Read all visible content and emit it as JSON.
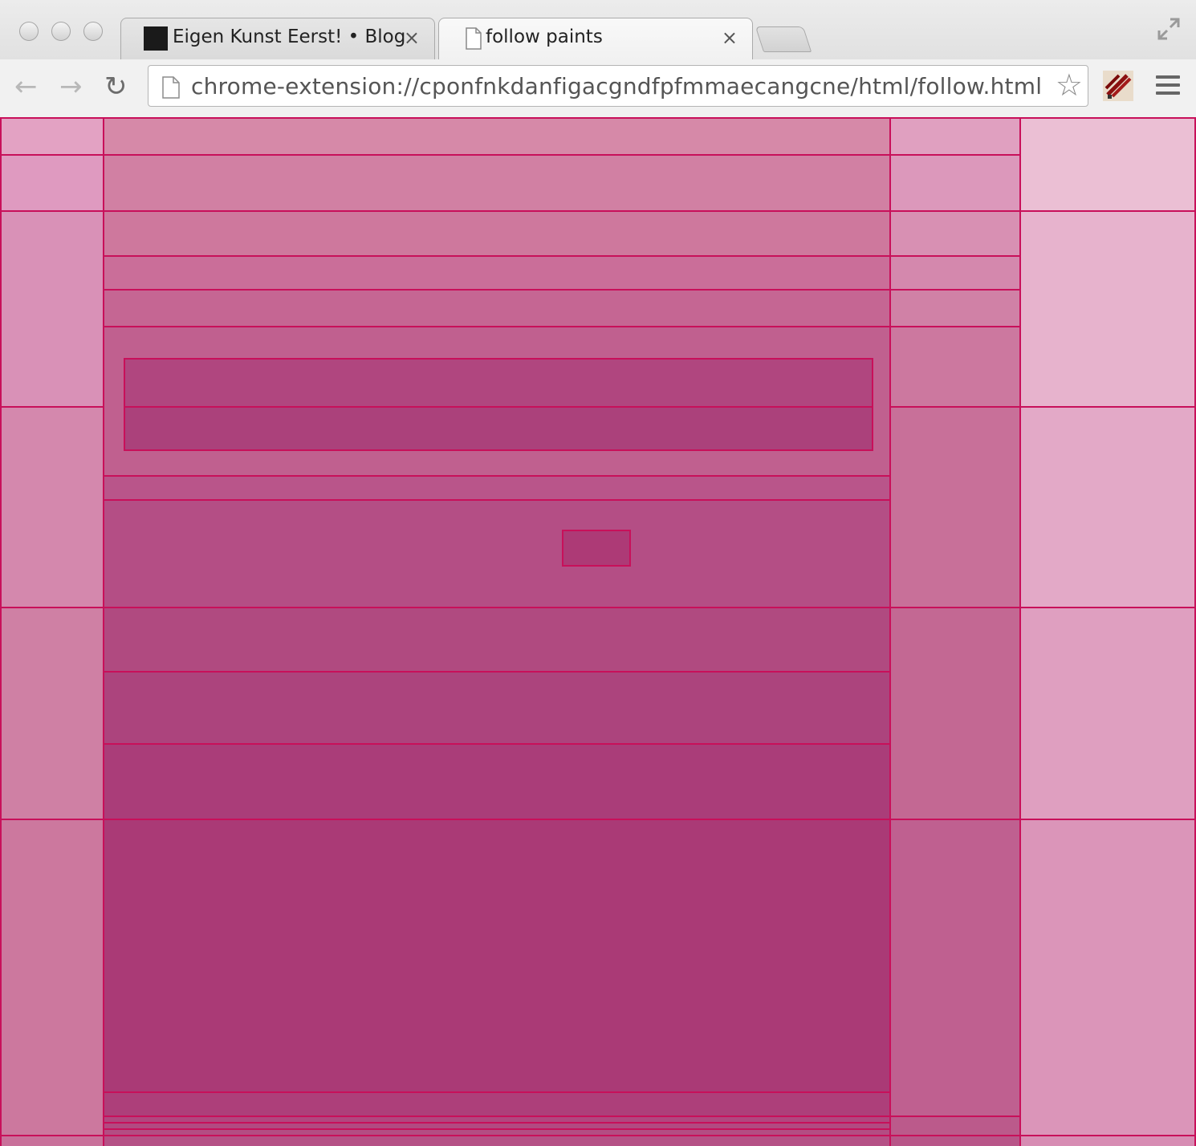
{
  "window": {
    "tabs": [
      {
        "title": "Eigen Kunst Eerst! • Blog",
        "close": "×",
        "active": false,
        "favicon": "black-square"
      },
      {
        "title": "follow paints",
        "close": "×",
        "active": true,
        "favicon": "document-icon"
      }
    ]
  },
  "toolbar": {
    "back_icon": "←",
    "forward_icon": "→",
    "reload_icon": "↻",
    "url": "chrome-extension://cponfnkdanfigacgndfpfmmaecangcne/html/follow.html",
    "star_icon": "☆"
  },
  "colors": {
    "overlay_border": "#c8105a",
    "palest": "#ebbfd4",
    "darkest": "#aa3a76"
  }
}
